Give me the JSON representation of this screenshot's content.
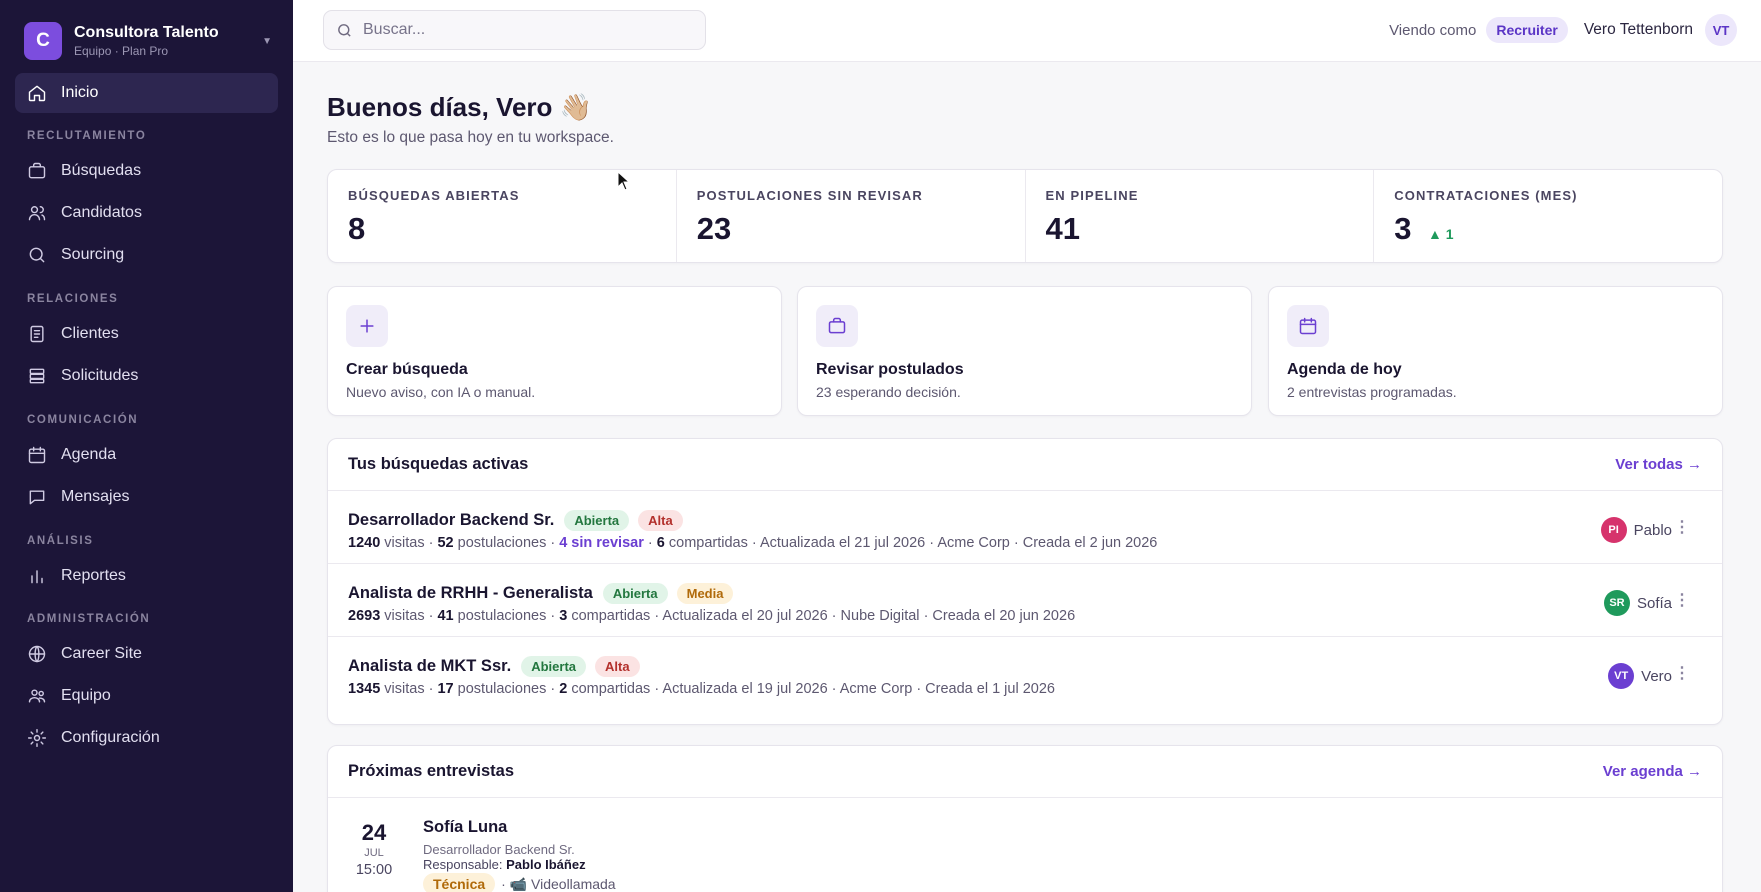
{
  "brand": {
    "initial": "C",
    "name": "Consultora Talento",
    "plan": "Equipo · Plan Pro"
  },
  "sidebar": {
    "home": "Inicio",
    "sections": {
      "recruiting": "RECLUTAMIENTO",
      "relations": "RELACIONES",
      "communication": "COMUNICACIÓN",
      "analysis": "ANÁLISIS",
      "admin": "ADMINISTRACIÓN"
    },
    "items": {
      "searches": "Búsquedas",
      "candidates": "Candidatos",
      "sourcing": "Sourcing",
      "clients": "Clientes",
      "requests": "Solicitudes",
      "agenda": "Agenda",
      "messages": "Mensajes",
      "reports": "Reportes",
      "career_site": "Career Site",
      "team": "Equipo",
      "settings": "Configuración"
    }
  },
  "topbar": {
    "search_placeholder": "Buscar...",
    "viewing_as": "Viendo como",
    "role": "Recruiter",
    "user_name": "Vero Tettenborn",
    "user_initials": "VT"
  },
  "greeting": {
    "title": "Buenos días, Vero 👋🏼",
    "subtitle": "Esto es lo que pasa hoy en tu workspace."
  },
  "stats": [
    {
      "label": "BÚSQUEDAS ABIERTAS",
      "value": "8",
      "delta": ""
    },
    {
      "label": "POSTULACIONES SIN REVISAR",
      "value": "23",
      "delta": ""
    },
    {
      "label": "EN PIPELINE",
      "value": "41",
      "delta": ""
    },
    {
      "label": "CONTRATACIONES (MES)",
      "value": "3",
      "delta": "▲ 1"
    }
  ],
  "actions": [
    {
      "title": "Crear búsqueda",
      "desc": "Nuevo aviso, con IA o manual."
    },
    {
      "title": "Revisar postulados",
      "desc": "23 esperando decisión."
    },
    {
      "title": "Agenda de hoy",
      "desc": "2 entrevistas programadas."
    }
  ],
  "jobs": {
    "title": "Tus búsquedas activas",
    "link": "Ver todas →",
    "rows": [
      {
        "title": "Desarrollador Backend Sr.",
        "status": "Abierta",
        "priority": "Alta",
        "visits": "1240",
        "visits_label": "visitas ·",
        "applications": "52",
        "applications_label": "postulaciones ·",
        "unreviewed": "4 sin revisar",
        "shared_sep": "·",
        "shared": "6",
        "shared_label": "compartidas · Actualizada el 21 jul 2026 ·",
        "client": "Acme Corp",
        "created": "· Creada el 2 jun 2026",
        "owner_initials": "PI",
        "owner_name": "Pablo",
        "owner_color": "#d6336c"
      },
      {
        "title": "Analista de RRHH - Generalista",
        "status": "Abierta",
        "priority": "Media",
        "visits": "2693",
        "visits_label": "visitas ·",
        "applications": "41",
        "applications_label": "postulaciones ·",
        "shared": "3",
        "shared_label": "compartidas · Actualizada el 20 jul 2026 ·",
        "client": "Nube Digital",
        "created": "· Creada el 20 jun 2026",
        "owner_initials": "SR",
        "owner_name": "Sofía",
        "owner_color": "#1f9a5c"
      },
      {
        "title": "Analista de MKT Ssr.",
        "status": "Abierta",
        "priority": "Alta",
        "visits": "1345",
        "visits_label": "visitas ·",
        "applications": "17",
        "applications_label": "postulaciones ·",
        "shared": "2",
        "shared_label": "compartidas · Actualizada el 19 jul 2026 ·",
        "client": "Acme Corp",
        "created": "· Creada el 1 jul 2026",
        "owner_initials": "VT",
        "owner_name": "Vero",
        "owner_color": "#6b3fd1"
      }
    ]
  },
  "interviews": {
    "title": "Próximas entrevistas",
    "link": "Ver agenda →",
    "rows": [
      {
        "day": "24",
        "month": "JUL",
        "time": "15:00",
        "name": "Sofía Luna",
        "role": "Desarrollador Backend Sr.",
        "resp_label": "Responsable:",
        "resp_name": "Pablo Ibáñez",
        "tag": "Técnica",
        "mode": "· 📹 Videollamada"
      }
    ]
  },
  "colors": {
    "sidebar_bg": "#1c1538",
    "accent": "#6b3fd1",
    "brand": "#7c4dde"
  }
}
